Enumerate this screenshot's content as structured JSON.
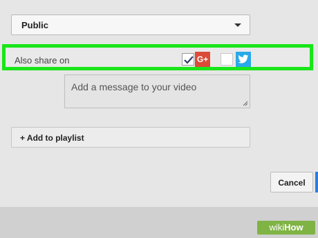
{
  "privacy_select": {
    "value": "Public"
  },
  "share": {
    "label": "Also share on",
    "googleplus": {
      "checked": true,
      "tile_text": "G+"
    },
    "twitter": {
      "checked": false
    }
  },
  "message": {
    "placeholder": "Add a message to your video"
  },
  "playlist": {
    "label": "+ Add to playlist"
  },
  "actions": {
    "cancel_label": "Cancel"
  },
  "watermark": {
    "wiki": "wiki",
    "how": "How"
  },
  "colors": {
    "highlight": "#19e619",
    "googleplus": "#dc4a38",
    "twitter": "#29a9e8",
    "primary_button": "#2b7de0"
  }
}
